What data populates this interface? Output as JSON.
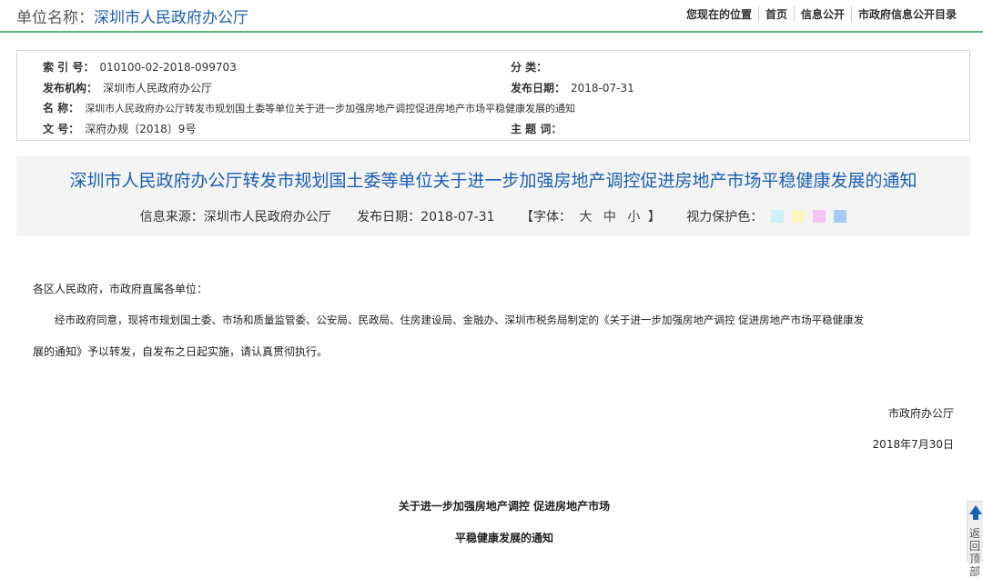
{
  "header": {
    "unit_label": "单位名称：",
    "unit_name": "深圳市人民政府办公厅",
    "nav": [
      "您现在的位置",
      "首页",
      "信息公开",
      "市政府信息公开目录"
    ]
  },
  "meta": {
    "index_label": "索 引 号：",
    "index_value": "010100-02-2018-099703",
    "category_label": "分 类：",
    "category_value": "",
    "publisher_label": "发布机构：",
    "publisher_value": "深圳市人民政府办公厅",
    "date_label": "发布日期：",
    "date_value": "2018-07-31",
    "name_label": "名 称：",
    "name_value": "深圳市人民政府办公厅转发市规划国土委等单位关于进一步加强房地产调控促进房地产市场平稳健康发展的通知",
    "docno_label": "文 号：",
    "docno_value": "深府办规〔2018〕9号",
    "keywords_label": "主 题 词：",
    "keywords_value": ""
  },
  "title": "深圳市人民政府办公厅转发市规划国土委等单位关于进一步加强房地产调控促进房地产市场平稳健康发展的通知",
  "info": {
    "source": "信息来源：深圳市人民政府办公厅",
    "date": "发布日期：2018-07-31",
    "font_prefix": "【字体：",
    "font_large": "大",
    "font_medium": "中",
    "font_small": "小",
    "font_suffix": "】",
    "eye_label": "视力保护色：",
    "colors": [
      "#c9f3f8",
      "#fbf6c2",
      "#f6c3f5",
      "#a3cdf6"
    ]
  },
  "body": {
    "salutation": "各区人民政府，市政府直属各单位：",
    "para1_line1": "经市政府同意，现将市规划国土委、市场和质量监管委、公安局、民政局、住房建设局、金融办、深圳市税务局制定的《关于进一步加强房地产调控 促进房地产市场平稳健康发",
    "para1_line2": "展的通知》予以转发，自发布之日起实施，请认真贯彻执行。",
    "signature": "市政府办公厅",
    "sign_date": "2018年7月30日",
    "subtitle1": "关于进一步加强房地产调控 促进房地产市场",
    "subtitle2": "平稳健康发展的通知"
  },
  "back_to_top": "返回顶部"
}
